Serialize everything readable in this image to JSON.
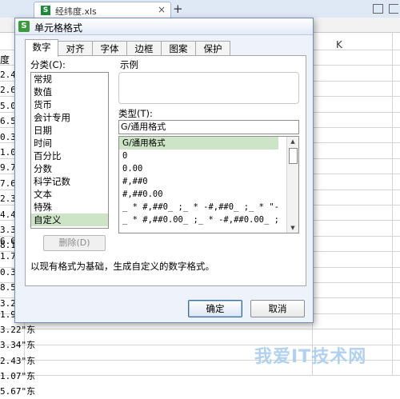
{
  "window": {
    "doc_tab_icon": "S",
    "doc_tab_name": "经纬度.xls",
    "doc_tab_close": "×",
    "new_tab": "+"
  },
  "sheet": {
    "column_k": "K",
    "header_text": "度",
    "left_values": [
      "2.4",
      "2.6",
      "5.0",
      "6.5",
      "0.3",
      "1.0",
      "9.7",
      "7.6",
      "2.3",
      "4.4",
      "3.3",
      "8.1"
    ],
    "lower_left_values": [
      "6.6",
      "1.7",
      "0.3",
      "8.5",
      "3.2"
    ],
    "bottom_values": [
      "1.92\"东",
      "3.22\"东",
      "3.34\"东",
      "2.43\"东",
      "1.07\"东",
      "5.67\"东"
    ]
  },
  "dialog": {
    "icon_text": "S",
    "title": "单元格格式",
    "tabs": [
      "数字",
      "对齐",
      "字体",
      "边框",
      "图案",
      "保护"
    ],
    "active_tab": 0,
    "category_label": "分类(C):",
    "categories": [
      "常规",
      "数值",
      "货币",
      "会计专用",
      "日期",
      "时间",
      "百分比",
      "分数",
      "科学记数",
      "文本",
      "特殊",
      "自定义"
    ],
    "selected_category": 11,
    "sample_label": "示例",
    "type_label": "类型(T):",
    "type_value": "G/通用格式",
    "formats": [
      "G/通用格式",
      "0",
      "0.00",
      "#,##0",
      "#,##0.00",
      "_ * #,##0_ ;_ * -#,##0_ ;_ * \"-\"_ ;_ @_",
      "_ * #,##0.00_ ;_ * -#,##0.00_ ;_ * \"-\"??_ ;_ @_"
    ],
    "selected_format": 0,
    "delete_button": "删除(D)",
    "description": "以现有格式为基础，生成自定义的数字格式。",
    "ok_button": "确定",
    "cancel_button": "取消"
  },
  "watermark": "我爱IT技术网"
}
